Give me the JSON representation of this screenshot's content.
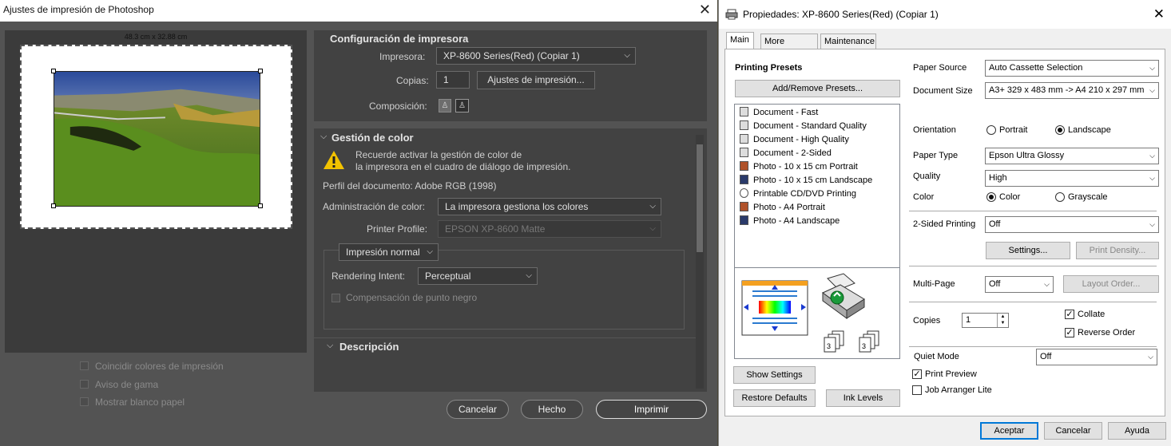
{
  "ps": {
    "title": "Ajustes de impresión de Photoshop",
    "close": "✕",
    "preview_size": "48.3 cm x 32.88 cm",
    "printer_section": {
      "title": "Configuración de impresora",
      "printer_label": "Impresora:",
      "printer_value": "XP-8600 Series(Red) (Copiar 1)",
      "copies_label": "Copias:",
      "copies_value": "1",
      "print_settings_button": "Ajustes de impresión...",
      "layout_label": "Composición:"
    },
    "color_section": {
      "title": "Gestión de color",
      "warning_line1": "Recuerde activar la gestión de color de",
      "warning_line2": "la impresora en el cuadro de diálogo de impresión.",
      "doc_profile": "Perfil del documento: Adobe RGB (1998)",
      "color_handling_label": "Administración de color:",
      "color_handling_value": "La impresora gestiona los colores",
      "printer_profile_label": "Printer Profile:",
      "printer_profile_value": "EPSON XP-8600 Matte",
      "print_mode_value": "Impresión normal",
      "rendering_intent_label": "Rendering Intent:",
      "rendering_intent_value": "Perceptual",
      "black_point_label": "Compensación de punto negro"
    },
    "description_title": "Descripción",
    "checks": [
      "Coincidir colores de impresión",
      "Aviso de gama",
      "Mostrar blanco papel"
    ],
    "buttons": {
      "cancel": "Cancelar",
      "done": "Hecho",
      "print": "Imprimir"
    }
  },
  "epson": {
    "title": "Propiedades: XP-8600 Series(Red) (Copiar 1)",
    "close": "✕",
    "tabs": [
      "Main",
      "More Options",
      "Maintenance"
    ],
    "presets_title": "Printing Presets",
    "add_remove_presets": "Add/Remove Presets...",
    "presets": [
      "Document - Fast",
      "Document - Standard Quality",
      "Document - High Quality",
      "Document - 2-Sided",
      "Photo - 10 x 15 cm Portrait",
      "Photo - 10 x 15 cm Landscape",
      "Printable CD/DVD Printing",
      "Photo - A4 Portrait",
      "Photo - A4 Landscape"
    ],
    "show_settings": "Show Settings",
    "restore_defaults": "Restore Defaults",
    "ink_levels": "Ink Levels",
    "paper_source_label": "Paper Source",
    "paper_source_value": "Auto Cassette Selection",
    "document_size_label": "Document Size",
    "document_size_value": "A3+ 329 x 483 mm -> A4 210 x 297 mm",
    "orientation_label": "Orientation",
    "portrait": "Portrait",
    "landscape": "Landscape",
    "paper_type_label": "Paper Type",
    "paper_type_value": "Epson Ultra Glossy",
    "quality_label": "Quality",
    "quality_value": "High",
    "color_label": "Color",
    "color_opt": "Color",
    "grayscale_opt": "Grayscale",
    "two_sided_label": "2-Sided Printing",
    "two_sided_value": "Off",
    "settings_button": "Settings...",
    "print_density_button": "Print Density...",
    "multipage_label": "Multi-Page",
    "multipage_value": "Off",
    "layout_order_button": "Layout Order...",
    "copies_label": "Copies",
    "copies_value": "1",
    "collate": "Collate",
    "reverse_order": "Reverse Order",
    "quiet_mode_label": "Quiet Mode",
    "quiet_mode_value": "Off",
    "print_preview": "Print Preview",
    "job_arranger": "Job Arranger Lite",
    "ok": "Aceptar",
    "cancel": "Cancelar",
    "help": "Ayuda"
  }
}
